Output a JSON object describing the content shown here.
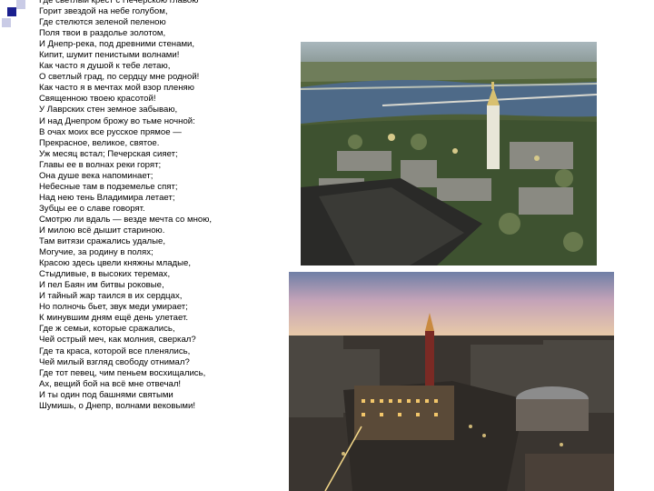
{
  "poem": {
    "lines": [
      "Где светлый крест с Печерскою главою",
      "Горит звездой на небе голубом,",
      "Где стелются зеленой пеленою",
      "Поля твои в раздолье золотом,",
      "И Днепр-река, под древними стенами,",
      "Кипит, шумит пенистыми волнами!",
      "Как часто я душой к тебе летаю,",
      "О светлый град, по сердцу мне родной!",
      "Как часто я в мечтах мой взор пленяю",
      "Священною твоею красотой!",
      "У Лаврских стен земное забываю,",
      "И над Днепром брожу во тьме ночной:",
      "В очах моих все русское прямое —",
      "Прекрасное, великое, святое.",
      "Уж месяц встал; Печерская сияет;",
      "Главы ее в волнах реки горят;",
      "Она душе века напоминает;",
      "Небесные там в подземелье спят;",
      "Над нею тень Владимира летает;",
      "Зубцы ее о славе говорят.",
      "Смотрю ли вдаль — везде мечта со мною,",
      "И милою всё дышит стариною.",
      "Там витязи сражались удалые,",
      "Могучие, за родину в полях;",
      "Красою здесь цвели княжны младые,",
      "Стыдливые, в высоких теремах,",
      "И пел Баян им битвы роковые,",
      "И тайный жар таился в их сердцах,",
      "Но полночь бьет, звук меди умирает;",
      "К минувшим дням ещё день улетает.",
      "Где ж семьи, которые сражались,",
      "Чей острый меч, как молния, сверкал?",
      "Где та краса, которой все пленялись,",
      "Чей милый взгляд свободу отнимал?",
      "Где тот певец, чим пеньем восхищались,",
      "Ах, вещий бой на всё мне отвечал!",
      "И ты один под башнями святыми",
      "Шумишь, о Днепр, волнами вековыми!"
    ]
  },
  "colors": {
    "bullet": "#1a1f8f",
    "bullet_shadow": "#c9cbe6"
  },
  "images": {
    "lavra": "aerial-photo-kiev-pechersk-lavra-dnieper",
    "city": "evening-photo-kiev-city-center"
  }
}
